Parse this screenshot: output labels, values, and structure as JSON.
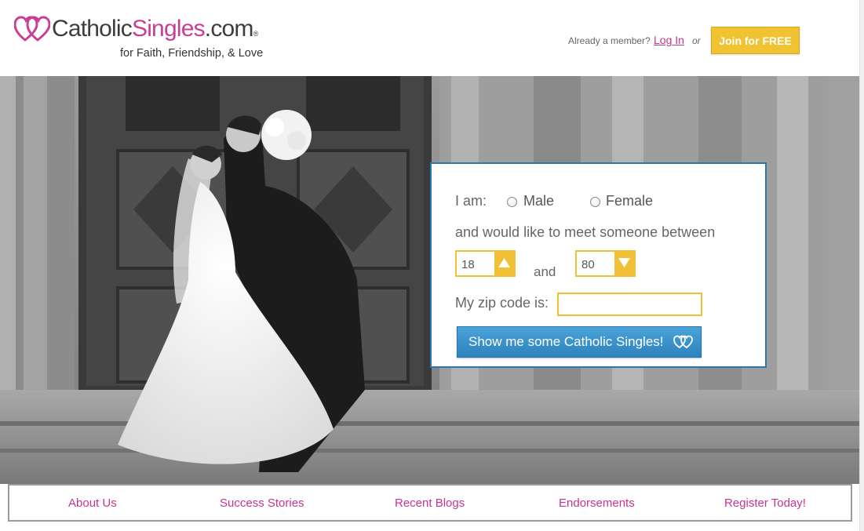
{
  "header": {
    "logo": {
      "part1": "Catholic",
      "part2": "Singles",
      "part3": ".com",
      "reg": "®",
      "tagline": "for Faith, Friendship, & Love"
    },
    "member_prompt": "Already a member?",
    "login_label": "Log In",
    "or_label": "or",
    "join_label": "Join for FREE"
  },
  "form": {
    "i_am_label": "I am:",
    "gender_options": [
      "Male",
      "Female"
    ],
    "meet_label": "and would like to meet someone between",
    "min_age": "18",
    "and_label": "and",
    "max_age": "80",
    "zip_label": "My zip code is:",
    "zip_value": "",
    "submit_label": "Show me some Catholic Singles!"
  },
  "footer": {
    "links": [
      "About Us",
      "Success Stories",
      "Recent Blogs",
      "Endorsements",
      "Register Today!"
    ]
  },
  "colors": {
    "brand_pink": "#c6358d",
    "accent_yellow": "#f1c232",
    "button_blue": "#2d83be",
    "panel_border": "#2b77b0"
  }
}
